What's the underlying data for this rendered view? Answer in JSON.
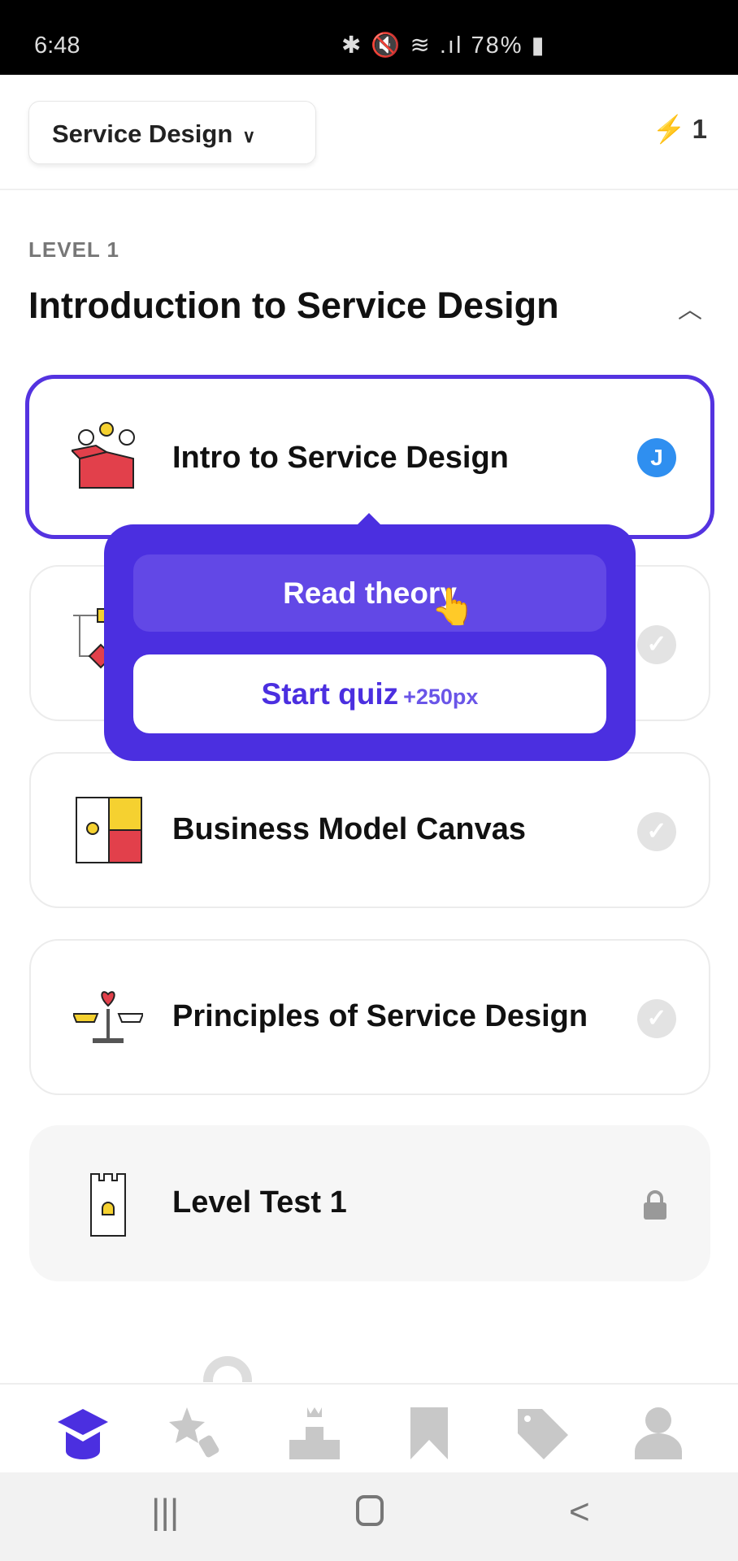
{
  "status_bar": {
    "time": "6:48",
    "icons": "✱ 🔇 ≋ .ıl",
    "battery": "78%"
  },
  "header": {
    "course": "Service Design",
    "streak_count": "1"
  },
  "level": {
    "label": "LEVEL 1",
    "title": "Introduction to Service Design"
  },
  "lessons": [
    {
      "title": "Intro to Service Design",
      "status": "in-progress",
      "avatar": "J"
    },
    {
      "title": "",
      "status": "completed"
    },
    {
      "title": "Business Model Canvas",
      "status": "completed"
    },
    {
      "title": "Principles of Service Design",
      "status": "completed"
    },
    {
      "title": "Level Test 1",
      "status": "locked"
    }
  ],
  "popover": {
    "read_label": "Read theory",
    "quiz_label": "Start quiz",
    "quiz_reward": "+250px"
  },
  "bottom_nav": [
    "learn",
    "achievements",
    "leaderboard",
    "bookmarks",
    "shop",
    "profile"
  ],
  "colors": {
    "accent": "#4b2fe0",
    "avatar": "#2f8ff0"
  }
}
